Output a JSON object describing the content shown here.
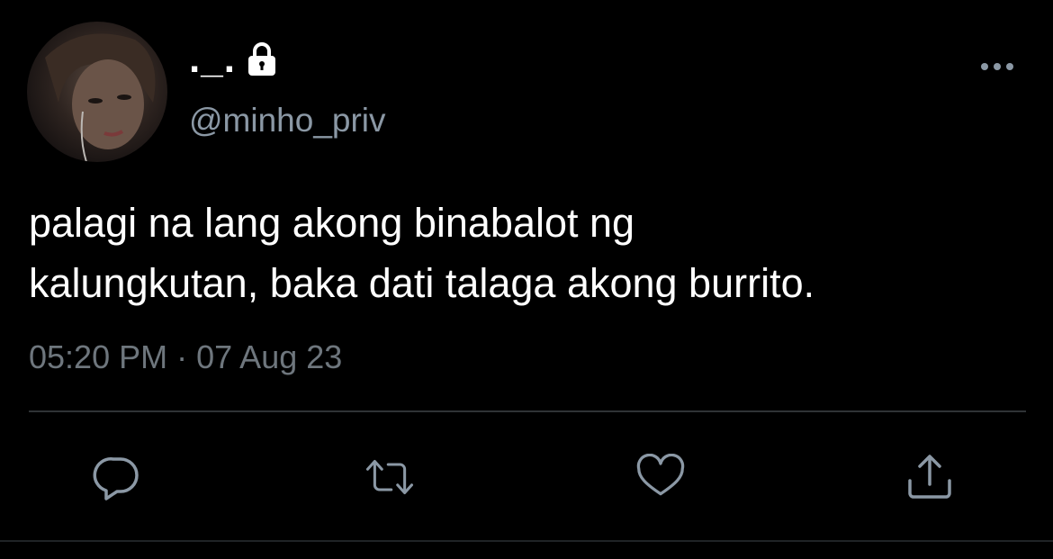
{
  "user": {
    "display_name": "._.",
    "handle": "@minho_priv",
    "protected_icon": "lock-icon",
    "avatar_icon": "profile-photo"
  },
  "tweet": {
    "lines": [
      "palagi na lang akong binabalot ng",
      "kalungkutan, baka dati talaga akong burrito."
    ],
    "time": "05:20 PM",
    "separator": "·",
    "date": "07 Aug 23"
  },
  "actions": {
    "reply": "reply-icon",
    "retweet": "retweet-icon",
    "like": "heart-icon",
    "share": "share-icon",
    "more": "more-icon"
  },
  "colors": {
    "background": "#000000",
    "text": "#ffffff",
    "secondary": "#8b98a5",
    "icon": "#8b98a5",
    "divider": "#2f3336"
  }
}
